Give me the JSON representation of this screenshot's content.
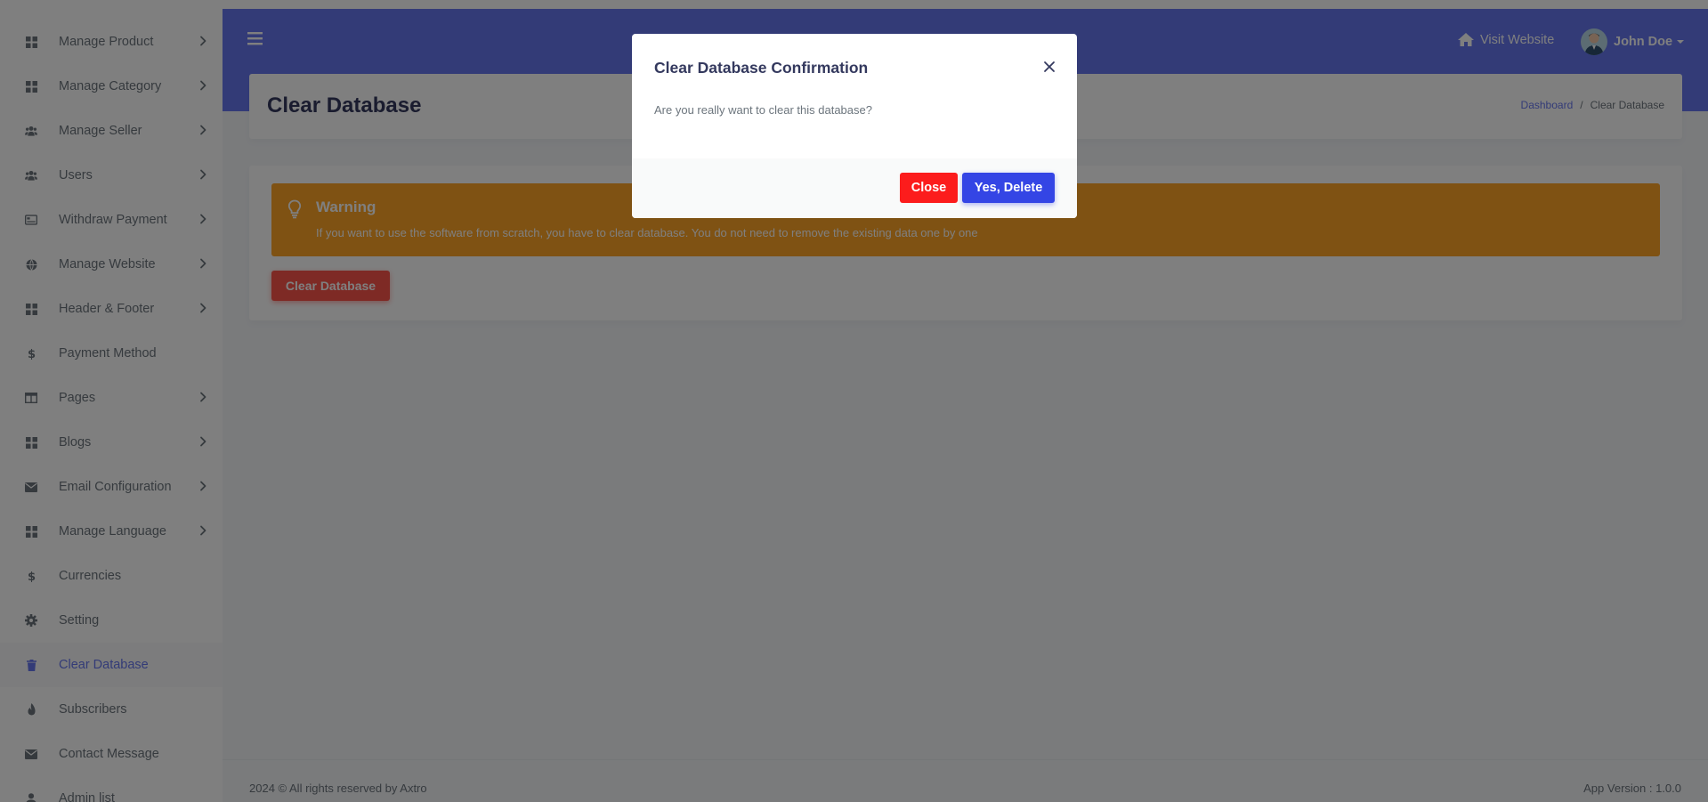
{
  "sidebar": {
    "items": [
      {
        "label": "Manage Product",
        "icon": "grid-icon",
        "has_submenu": true
      },
      {
        "label": "Manage Category",
        "icon": "grid-icon",
        "has_submenu": true
      },
      {
        "label": "Manage Seller",
        "icon": "users-icon",
        "has_submenu": true
      },
      {
        "label": "Users",
        "icon": "users-icon",
        "has_submenu": true
      },
      {
        "label": "Withdraw Payment",
        "icon": "card-icon",
        "has_submenu": true
      },
      {
        "label": "Manage Website",
        "icon": "globe-icon",
        "has_submenu": true
      },
      {
        "label": "Header & Footer",
        "icon": "grid-icon",
        "has_submenu": true
      },
      {
        "label": "Payment Method",
        "icon": "dollar-icon",
        "has_submenu": false
      },
      {
        "label": "Pages",
        "icon": "columns-icon",
        "has_submenu": true
      },
      {
        "label": "Blogs",
        "icon": "grid-icon",
        "has_submenu": true
      },
      {
        "label": "Email Configuration",
        "icon": "envelope-icon",
        "has_submenu": true
      },
      {
        "label": "Manage Language",
        "icon": "grid-icon",
        "has_submenu": true
      },
      {
        "label": "Currencies",
        "icon": "dollar-icon",
        "has_submenu": false
      },
      {
        "label": "Setting",
        "icon": "gear-icon",
        "has_submenu": false
      },
      {
        "label": "Clear Database",
        "icon": "trash-icon",
        "has_submenu": false,
        "active": true
      },
      {
        "label": "Subscribers",
        "icon": "fire-icon",
        "has_submenu": false
      },
      {
        "label": "Contact Message",
        "icon": "envelope-icon",
        "has_submenu": false
      },
      {
        "label": "Admin list",
        "icon": "user-icon",
        "has_submenu": false
      }
    ]
  },
  "navbar": {
    "visit_website": "Visit Website",
    "user_name": "John Doe"
  },
  "header": {
    "title": "Clear Database",
    "breadcrumb": {
      "link": "Dashboard",
      "separator": "/",
      "current": "Clear Database"
    }
  },
  "alert": {
    "title": "Warning",
    "text": "If you want to use the software from scratch, you have to clear database. You do not need to remove the existing data one by one"
  },
  "main": {
    "clear_button": "Clear Database"
  },
  "footer": {
    "copyright": "2024 © All rights reserved by Axtro",
    "version": "App Version : 1.0.0"
  },
  "modal": {
    "title": "Clear Database Confirmation",
    "body": "Are you really want to clear this database?",
    "close_button": "Close",
    "confirm_button": "Yes, Delete"
  },
  "colors": {
    "primary": "#6777ef",
    "warning": "#ffa426",
    "danger": "#fc544b",
    "confirm": "#3445e5"
  }
}
